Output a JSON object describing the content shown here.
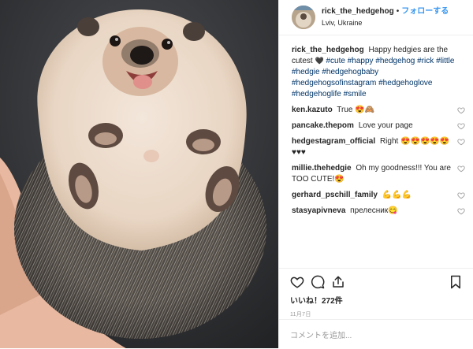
{
  "header": {
    "username": "rick_the_hedgehog",
    "separator": "•",
    "follow_label": "フォローする",
    "location": "Lviv, Ukraine"
  },
  "caption": {
    "user": "rick_the_hedgehog",
    "text_start": "Happy hedgies are the cutest",
    "emoji": "🖤",
    "tags": [
      "#cute",
      "#happy",
      "#hedgehog",
      "#rick",
      "#little",
      "#hedgie",
      "#hedgehogbaby",
      "#hedgehogsofinstagram",
      "#hedgehoglove",
      "#hedgehoglife",
      "#smile"
    ]
  },
  "comments": [
    {
      "user": "ken.kazuto",
      "text": "True 😍🙈"
    },
    {
      "user": "pancake.thepom",
      "text": "Love your page"
    },
    {
      "user": "hedgestagram_official",
      "text": "Right 😍😍😍😍😍♥♥♥"
    },
    {
      "user": "millie.thehedgie",
      "text": "Oh my goodness!!! You are TOO CUTE!😍"
    },
    {
      "user": "gerhard_pschill_family",
      "text": "💪💪💪"
    },
    {
      "user": "stasyapivneva",
      "text": "прелесник😋"
    }
  ],
  "actions": {
    "likes": "いいね！272件",
    "date": "11月7日"
  },
  "add_comment": {
    "placeholder": "コメントを追加..."
  }
}
